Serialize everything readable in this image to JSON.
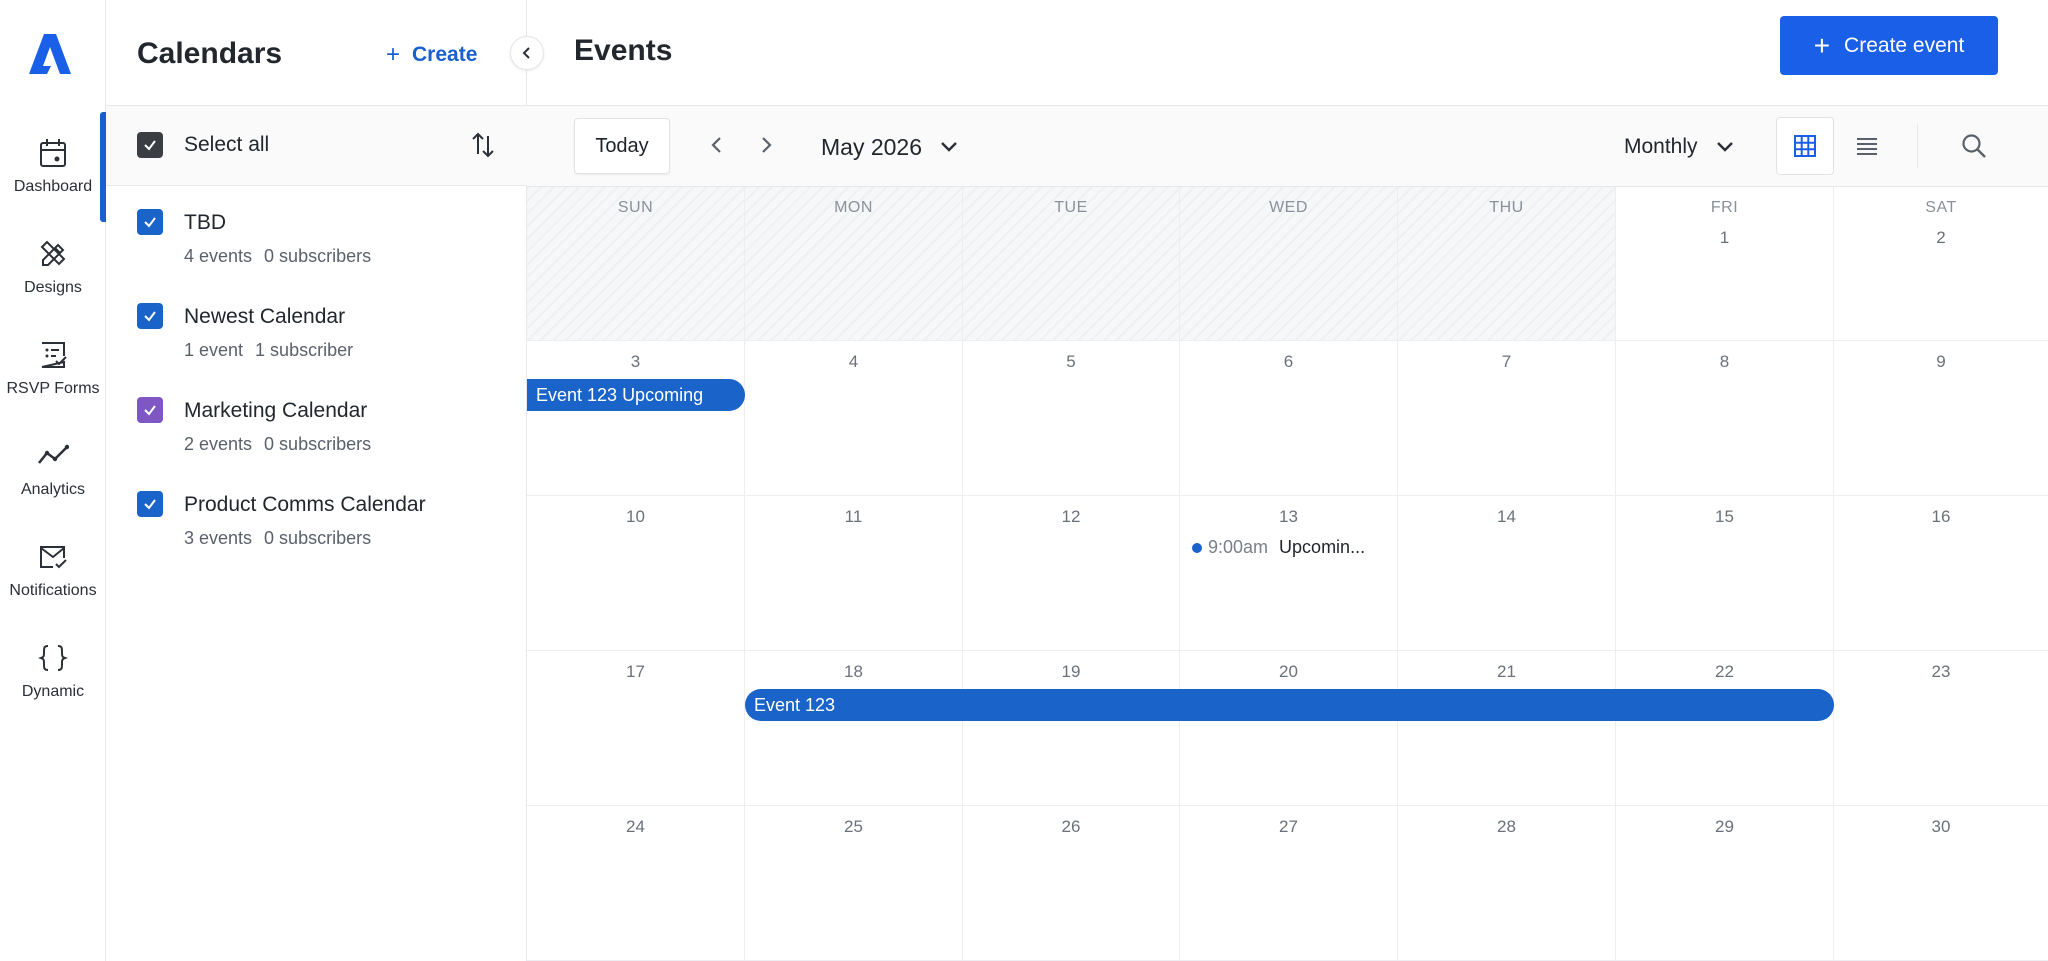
{
  "rail": {
    "items": [
      {
        "label": "Dashboard",
        "icon": "calendar-icon"
      },
      {
        "label": "Designs",
        "icon": "design-tools-icon"
      },
      {
        "label": "RSVP Forms",
        "icon": "form-icon"
      },
      {
        "label": "Analytics",
        "icon": "analytics-icon"
      },
      {
        "label": "Notifications",
        "icon": "mail-icon"
      },
      {
        "label": "Dynamic",
        "icon": "braces-icon"
      }
    ]
  },
  "panel": {
    "title": "Calendars",
    "create_label": "Create",
    "select_all_label": "Select all",
    "calendars": [
      {
        "name": "TBD",
        "events": "4 events",
        "subscribers": "0 subscribers",
        "color": "#1a63c9"
      },
      {
        "name": "Newest Calendar",
        "events": "1 event",
        "subscribers": "1 subscriber",
        "color": "#1a63c9"
      },
      {
        "name": "Marketing Calendar",
        "events": "2 events",
        "subscribers": "0 subscribers",
        "color": "#7e57c2"
      },
      {
        "name": "Product Comms Calendar",
        "events": "3 events",
        "subscribers": "0 subscribers",
        "color": "#1a63c9"
      }
    ]
  },
  "main": {
    "title": "Events",
    "create_event_label": "Create event",
    "today_label": "Today",
    "month_label": "May 2026",
    "view_label": "Monthly"
  },
  "calendar": {
    "weekdays": [
      "SUN",
      "MON",
      "TUE",
      "WED",
      "THU",
      "FRI",
      "SAT"
    ],
    "weeks": [
      [
        "",
        "",
        "",
        "",
        "",
        "1",
        "2"
      ],
      [
        "3",
        "4",
        "5",
        "6",
        "7",
        "8",
        "9"
      ],
      [
        "10",
        "11",
        "12",
        "13",
        "14",
        "15",
        "16"
      ],
      [
        "17",
        "18",
        "19",
        "20",
        "21",
        "22",
        "23"
      ],
      [
        "24",
        "25",
        "26",
        "27",
        "28",
        "29",
        "30"
      ]
    ],
    "events": [
      {
        "type": "bar",
        "week": 1,
        "start_col": 0,
        "span": 1,
        "title": "Event 123 Upcoming"
      },
      {
        "type": "timed",
        "week": 2,
        "col": 3,
        "time": "9:00am",
        "title": "Upcomin..."
      },
      {
        "type": "bar",
        "week": 3,
        "start_col": 1,
        "span": 5,
        "title": "Event 123"
      }
    ]
  },
  "colors": {
    "accent": "#1a5fe8",
    "event": "#1a63c9"
  }
}
